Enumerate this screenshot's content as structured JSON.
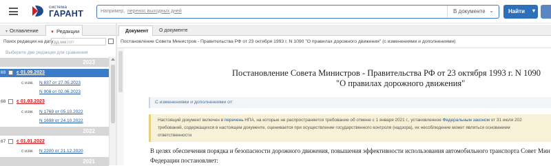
{
  "header": {
    "logo_small": "система",
    "logo_big": "ГАРАНТ",
    "search_prefix": "Например,",
    "search_link": "перенос выходных дней",
    "search_scope": "В документе",
    "find_label": "Найти",
    "colors": {
      "accent": "#2d6fb8",
      "logo": "#1a3f7a"
    }
  },
  "left_panel": {
    "tabs": [
      {
        "label": "Оглавление",
        "active": false
      },
      {
        "label": "Редакции",
        "active": true
      }
    ],
    "date_label": "Поиск редакции на дату",
    "date_placeholder": "дд.мм.гггг",
    "choose_hint": "Выберите две редакции для сравнения",
    "years": [
      "2023",
      "2022",
      "2021"
    ],
    "editions": [
      {
        "num": "69",
        "date": "с 01.09.2023",
        "selected": true
      },
      {
        "num": "68",
        "date": "с 01.03.2023",
        "selected": false
      },
      {
        "num": "67",
        "date": "с 01.01.2022",
        "selected": false
      }
    ],
    "changes": {
      "prefix": "с изм.",
      "e69a": "N 837 от 27.05.2023",
      "e69b": "N 908 от 02.06.2023",
      "e68a": "N 1769 от 05.10.2022",
      "e68b": "N 1698 от 24.10.2022",
      "e67a": "N 2200 от 21.12.2020"
    }
  },
  "right_panel": {
    "tabs": [
      {
        "label": "Документ",
        "active": true
      },
      {
        "label": "О документе",
        "active": false
      }
    ],
    "breadcrumb": "Постановление Совета Министров - Правительства РФ от 23 октября 1993 г. N 1090 \"О правилах дорожного движения\" (с изменениями и дополнениями)",
    "title_line1": "Постановление Совета Министров - Правительства РФ от 23 октября 1993 г. N 1090",
    "title_line2": "\"О правилах дорожного движения\"",
    "changes_link": "С изменениями и дополнениями от:",
    "notice": {
      "l1_pre": "Настоящий документ включен в ",
      "l1_link1": "перечень",
      "l1_mid": " НПА, на которые не распространяется требование об отмене с 1 января 2021 г., установленное ",
      "l1_link2": "Федеральным законом",
      "l1_post": " от 31 июля 202",
      "l2": "требований, содержащихся в настоящем документе, оценивается при осуществлении государственного контроля (надзора), их несоблюдение может являться основанием",
      "l3": "ответственности"
    },
    "body_line1": "В целях обеспечения порядка и безопасности дорожного движения, повышения эффективности использования автомобильного транспорта Совет Мин",
    "body_line2": "Федерации постановляет:"
  }
}
